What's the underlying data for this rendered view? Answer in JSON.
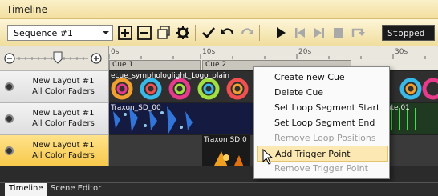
{
  "window": {
    "title": "Timeline"
  },
  "toolbar": {
    "sequence_select": "Sequence #1",
    "status": "Stopped",
    "icons": [
      "add-icon",
      "remove-icon",
      "duplicate-icon",
      "gear-icon",
      "check-icon",
      "undo-icon",
      "redo-icon",
      "play-icon",
      "skip-back-icon",
      "skip-forward-icon",
      "stop-icon",
      "loop-icon"
    ]
  },
  "ruler": {
    "ticks": [
      "0s",
      "10s",
      "20s",
      "30s"
    ],
    "cues": [
      {
        "label": "Cue 1"
      },
      {
        "label": "Cue 2"
      }
    ]
  },
  "tracks": [
    {
      "line1": "New Layout #1",
      "line2": "All Color Faders",
      "clip_label": "ecue_symphologlight_Logo_plain",
      "selected": false
    },
    {
      "line1": "New Layout #1",
      "line2": "All Color Faders",
      "clip_label": "Traxon_SD_00",
      "clip_label_end": "ate 01",
      "selected": false
    },
    {
      "line1": "New Layout #1",
      "line2": "All Color Faders",
      "clip_label": "Traxon SD 0",
      "selected": true
    }
  ],
  "context_menu": {
    "items": [
      {
        "label": "Create new Cue",
        "enabled": true
      },
      {
        "label": "Delete Cue",
        "enabled": true
      },
      {
        "label": "Set Loop Segment Start",
        "enabled": true
      },
      {
        "label": "Set Loop Segment  End",
        "enabled": true
      },
      {
        "label": "Remove Loop Positions",
        "enabled": false
      },
      {
        "label": "Add Trigger Point",
        "enabled": true,
        "highlighted": true
      },
      {
        "label": "Remove Trigger Point",
        "enabled": false
      }
    ]
  },
  "bottom_tabs": [
    {
      "label": "Timeline",
      "active": true
    },
    {
      "label": "Scene Editor",
      "active": false
    }
  ],
  "colors": {
    "title_bg": "#f6e7b0",
    "selected_track": "#f7c84a",
    "menu_highlight": "#fbe8b2"
  }
}
